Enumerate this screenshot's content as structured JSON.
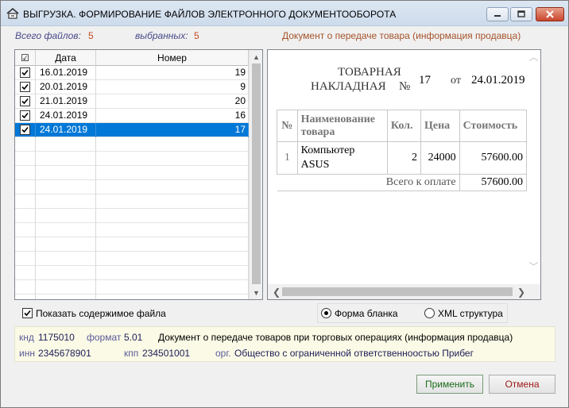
{
  "window": {
    "title": "ВЫГРУЗКА.   ФОРМИРОВАНИЕ ФАЙЛОВ ЭЛЕКТРОННОГО ДОКУМЕНТООБОРОТА"
  },
  "summary": {
    "total_label": "Всего файлов:",
    "total_value": "5",
    "selected_label": "выбранных:",
    "selected_value": "5",
    "document_title": "Документ о передаче товара (информация продавца)"
  },
  "grid": {
    "headers": {
      "check": "☑",
      "date": "Дата",
      "number": "Номер"
    },
    "rows": [
      {
        "date": "16.01.2019",
        "number": "19",
        "checked": true
      },
      {
        "date": "20.01.2019",
        "number": "9",
        "checked": true
      },
      {
        "date": "21.01.2019",
        "number": "20",
        "checked": true
      },
      {
        "date": "24.01.2019",
        "number": "16",
        "checked": true
      },
      {
        "date": "24.01.2019",
        "number": "17",
        "checked": true,
        "selected": true
      }
    ]
  },
  "preview": {
    "heading_line1": "ТОВАРНАЯ",
    "heading_line2": "НАКЛАДНАЯ",
    "number_sign": "№",
    "number": "17",
    "from_label": "от",
    "date": "24.01.2019",
    "table_headers": {
      "no": "№",
      "name": "Наименование товара",
      "qty": "Кол.",
      "price": "Цена",
      "sum": "Стоимость"
    },
    "items": [
      {
        "no": "1",
        "name": "Компьютер ASUS",
        "qty": "2",
        "price": "24000",
        "sum": "57600.00"
      }
    ],
    "total_label": "Всего к оплате",
    "total_value": "57600.00"
  },
  "options": {
    "show_file_label": "Показать содержимое файла",
    "show_file_checked": true,
    "radio_form_label": "Форма бланка",
    "radio_xml_label": "XML структура",
    "selected_view": "form"
  },
  "meta": {
    "knd_label": "кнд",
    "knd_value": "1175010",
    "format_label": "формат",
    "format_value": "5.01",
    "doc_description": "Документ о передаче товаров при торговых операциях (информация продавца)",
    "inn_label": "инн",
    "inn_value": "2345678901",
    "kpp_label": "кпп",
    "kpp_value": "234501001",
    "org_label": "орг.",
    "org_value": "Общество с ограниченной ответственноостью Прибег"
  },
  "buttons": {
    "apply": "Применить",
    "cancel": "Отмена"
  },
  "colors": {
    "selection": "#0078d7",
    "info_panel": "#fafae6",
    "accent_values": "#c84a1e"
  }
}
